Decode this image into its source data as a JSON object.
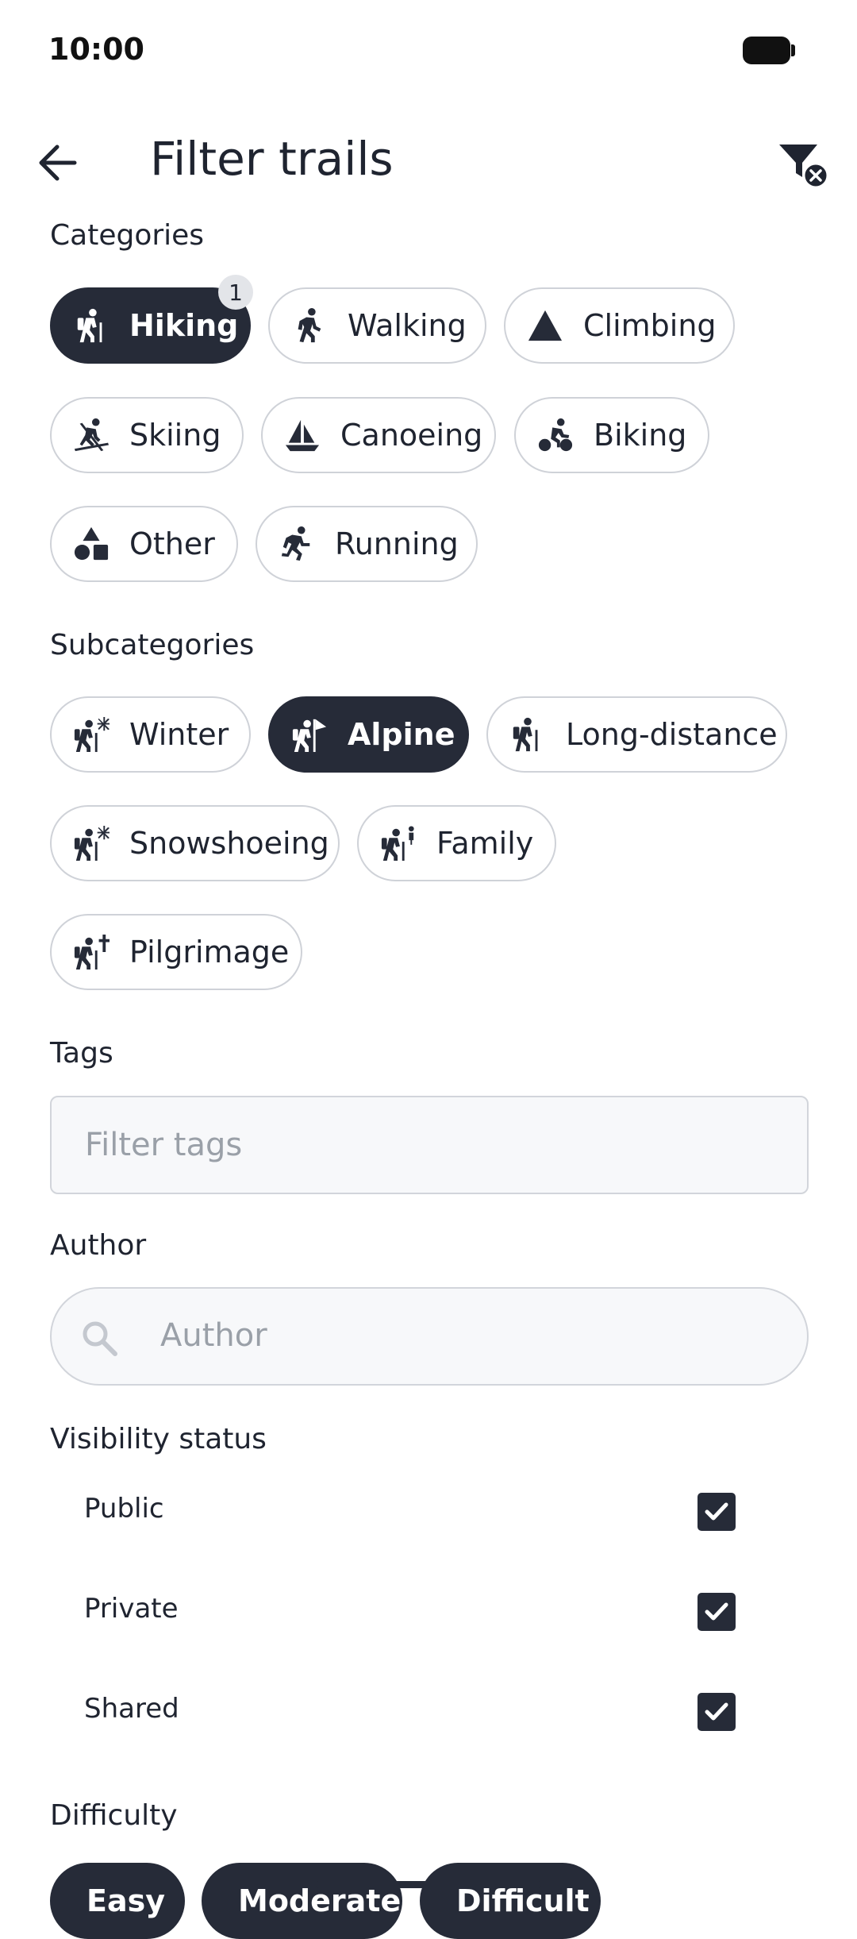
{
  "status_bar": {
    "time": "10:00"
  },
  "header": {
    "title": "Filter trails"
  },
  "categories": {
    "label": "Categories",
    "selected_count": "1",
    "chips": [
      {
        "label": "Hiking",
        "icon": "hiking-icon",
        "selected": true
      },
      {
        "label": "Walking",
        "icon": "walking-icon",
        "selected": false
      },
      {
        "label": "Climbing",
        "icon": "mountain-icon",
        "selected": false
      },
      {
        "label": "Skiing",
        "icon": "skiing-icon",
        "selected": false
      },
      {
        "label": "Canoeing",
        "icon": "sailboat-icon",
        "selected": false
      },
      {
        "label": "Biking",
        "icon": "biking-icon",
        "selected": false
      },
      {
        "label": "Other",
        "icon": "shapes-icon",
        "selected": false
      },
      {
        "label": "Running",
        "icon": "running-icon",
        "selected": false
      }
    ]
  },
  "subcategories": {
    "label": "Subcategories",
    "chips": [
      {
        "label": "Winter",
        "icon": "hiker-snowflake-icon",
        "selected": false
      },
      {
        "label": "Alpine",
        "icon": "hiker-flag-icon",
        "selected": true
      },
      {
        "label": "Long-distance",
        "icon": "hiker-icon",
        "selected": false
      },
      {
        "label": "Snowshoeing",
        "icon": "hiker-snowflake-icon",
        "selected": false
      },
      {
        "label": "Family",
        "icon": "hiker-child-icon",
        "selected": false
      },
      {
        "label": "Pilgrimage",
        "icon": "hiker-cross-icon",
        "selected": false
      }
    ]
  },
  "tags": {
    "label": "Tags",
    "placeholder": "Filter tags"
  },
  "author": {
    "label": "Author",
    "placeholder": "Author"
  },
  "visibility": {
    "label": "Visibility status",
    "options": [
      {
        "label": "Public",
        "checked": true
      },
      {
        "label": "Private",
        "checked": true
      },
      {
        "label": "Shared",
        "checked": true
      }
    ]
  },
  "difficulty": {
    "label": "Difficulty",
    "chips": [
      {
        "label": "Easy",
        "selected": true
      },
      {
        "label": "Moderate",
        "selected": true
      },
      {
        "label": "Difficult",
        "selected": true
      }
    ]
  },
  "colors": {
    "primary": "#262b38",
    "outline": "#cfd2d8",
    "input_bg": "#f7f8fa",
    "placeholder": "#9aa0a8"
  }
}
